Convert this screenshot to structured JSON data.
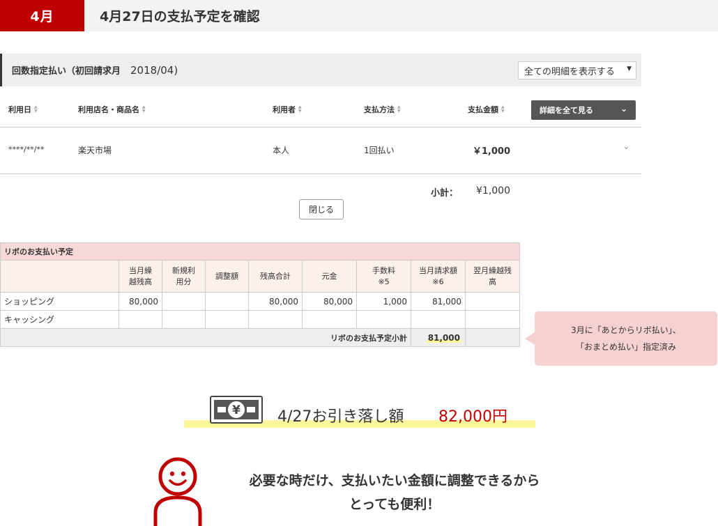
{
  "header": {
    "month": "4月",
    "title": "4月27日の支払予定を確認"
  },
  "plan": {
    "label": "回数指定払い（初回請求月",
    "year": "2018/04)",
    "select_value": "全ての明細を表示する"
  },
  "columns": {
    "date": "利用日",
    "shop": "利用店名・商品名",
    "user": "利用者",
    "method": "支払方法",
    "amount": "支払金額"
  },
  "detail_button": "詳細を全て見る",
  "rows": [
    {
      "date": "****/**/**",
      "shop": "楽天市場",
      "user": "本人",
      "method": "1回払い",
      "amount": "￥1,000"
    }
  ],
  "subtotal": {
    "label": "小計：",
    "value": "¥1,000"
  },
  "close_button": "閉じる",
  "revo": {
    "title": "リボのお支払い予定",
    "headers": [
      "",
      "当月繰\n越残高",
      "新規利\n用分",
      "調整額",
      "残高合計",
      "元金",
      "手数料\n※5",
      "当月請求額\n※6",
      "翌月繰越残\n高"
    ],
    "rows": [
      {
        "label": "ショッピング",
        "cells": [
          "80,000",
          "",
          "",
          "80,000",
          "80,000",
          "1,000",
          "81,000",
          ""
        ]
      },
      {
        "label": "キャッシング",
        "cells": [
          "",
          "",
          "",
          "",
          "",
          "",
          "",
          ""
        ]
      }
    ],
    "footer_label": "リボのお支払予定小計",
    "footer_value": "81,000"
  },
  "callout": {
    "line1": "3月に「あとからリボ払い」、",
    "line2": "「おまとめ払い」指定済み"
  },
  "withdrawal": {
    "label": "4/27お引き落し額",
    "amount": "82,000円",
    "icon": "yen-banknote-icon"
  },
  "message": {
    "line1": "必要な時だけ、支払いたい金額に調整できるから",
    "line2": "とっても便利！"
  },
  "colors": {
    "brand_red": "#bf0000",
    "table_title_bg": "#f6d8d8",
    "table_header_bg": "#fbf0ea",
    "callout_bg": "#f6d1d1",
    "highlight_yellow": "#fdf69c"
  }
}
